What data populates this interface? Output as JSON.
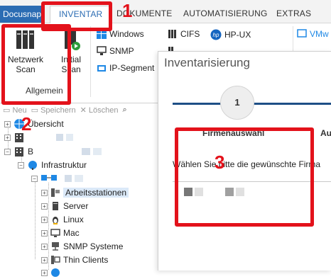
{
  "ribbon": {
    "app_tab": "Docusnap",
    "tabs": [
      "INVENTAR",
      "DOKUMENTE",
      "AUTOMATISIERUNG",
      "EXTRAS"
    ],
    "big_buttons": [
      {
        "line1": "Netzwerk",
        "line2": "Scan"
      },
      {
        "line1": "Initial",
        "line2": "Scan"
      }
    ],
    "group_label": "Allgemein",
    "small_buttons": [
      "Windows",
      "SNMP",
      "IP-Segment",
      "CIFS",
      "HP-UX",
      "VMw"
    ]
  },
  "toolbar": {
    "new": "Neu",
    "save": "Speichern",
    "delete": "Löschen"
  },
  "tree": {
    "overview": "Übersicht",
    "company_initial": "B",
    "infrastructure": "Infrastruktur",
    "items": [
      "Arbeitsstationen",
      "Server",
      "Linux",
      "Mac",
      "SNMP Systeme",
      "Thin Clients"
    ]
  },
  "dialog": {
    "title": "Inventarisierung",
    "step_number": "1",
    "step_label": "Firmenauswahl",
    "next_step_partial": "Au",
    "instruction": "Wählen Sie bitte die gewünschte Firma"
  },
  "annotations": [
    "1",
    "2",
    "3"
  ],
  "colors": {
    "accent": "#2b6cb3",
    "step_line": "#1e4f86",
    "annotation": "#e3121b"
  }
}
